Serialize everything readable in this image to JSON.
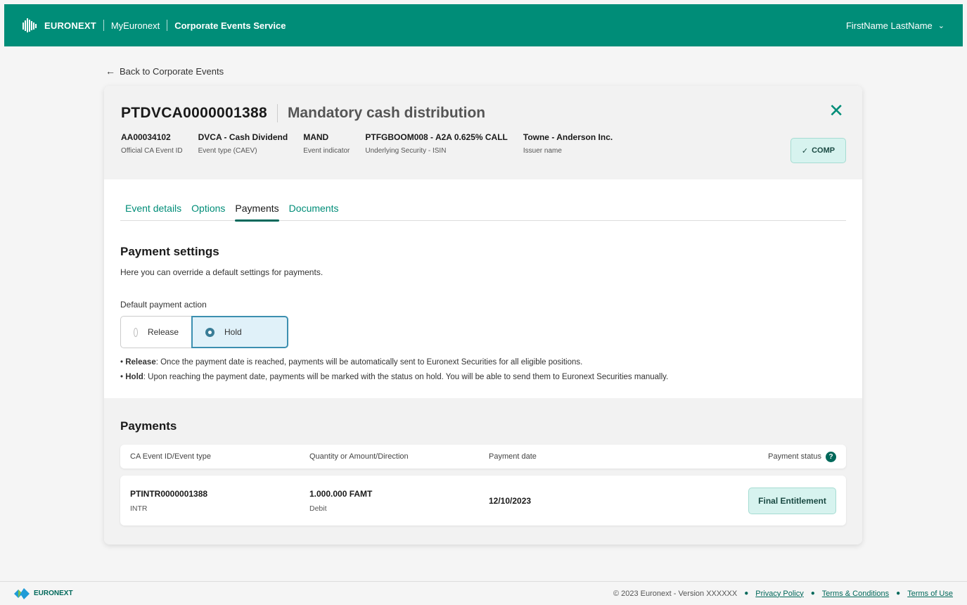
{
  "header": {
    "brand": "EURONEXT",
    "app_link": "MyEuronext",
    "service": "Corporate Events Service",
    "user_name": "FirstName LastName"
  },
  "back_link": "Back to Corporate Events",
  "event": {
    "id": "PTDVCA0000001388",
    "title": "Mandatory cash distribution",
    "status_badge": "COMP",
    "meta": [
      {
        "value": "AA00034102",
        "label": "Official CA Event ID"
      },
      {
        "value": "DVCA - Cash Dividend",
        "label": "Event type (CAEV)"
      },
      {
        "value": "MAND",
        "label": "Event indicator"
      },
      {
        "value": "PTFGBOOM008 - A2A 0.625% CALL",
        "label": "Underlying Security - ISIN"
      },
      {
        "value": "Towne - Anderson Inc.",
        "label": "Issuer name"
      }
    ]
  },
  "tabs": [
    {
      "label": "Event details"
    },
    {
      "label": "Options"
    },
    {
      "label": "Payments"
    },
    {
      "label": "Documents"
    }
  ],
  "payment_settings": {
    "heading": "Payment settings",
    "description": "Here you can override a default settings for payments.",
    "field_label": "Default payment action",
    "options": [
      {
        "label": "Release",
        "selected": false
      },
      {
        "label": "Hold",
        "selected": true
      }
    ],
    "notes": [
      {
        "bold": "Release",
        "text": ": Once the payment date is reached, payments will be automatically sent to Euronext Securities for all eligible positions."
      },
      {
        "bold": "Hold",
        "text": ": Upon reaching the payment date, payments will be marked with the status on hold. You will be able to send them to Euronext Securities manually."
      }
    ]
  },
  "payments": {
    "heading": "Payments",
    "columns": [
      "CA Event ID/Event type",
      "Quantity or Amount/Direction",
      "Payment date",
      "Payment status"
    ],
    "rows": [
      {
        "event_id": "PTINTR0000001388",
        "event_type": "INTR",
        "quantity": "1.000.000 FAMT",
        "direction": "Debit",
        "payment_date": "12/10/2023",
        "status": "Final Entitlement"
      }
    ]
  },
  "footer": {
    "brand": "EURONEXT",
    "copyright": "© 2023 Euronext - Version XXXXXX",
    "links": [
      "Privacy Policy",
      "Terms & Conditions",
      "Terms of Use"
    ]
  },
  "colors": {
    "brand_green": "#008d78",
    "status_bg": "#d7f3ef",
    "selected_radio": "#3c8fb0"
  }
}
